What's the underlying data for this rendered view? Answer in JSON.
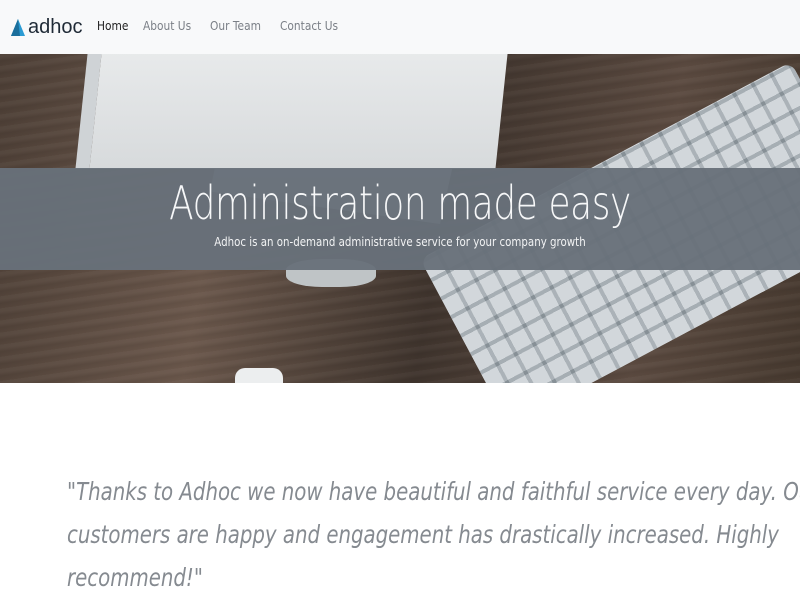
{
  "brand": {
    "name": "adhoc",
    "logo_icon": "triangle-logo-icon",
    "logo_color": "#2b9bd3"
  },
  "nav": {
    "items": [
      {
        "label": "Home",
        "active": true
      },
      {
        "label": "About Us",
        "active": false
      },
      {
        "label": "Our Team",
        "active": false
      },
      {
        "label": "Contact Us",
        "active": false
      }
    ]
  },
  "hero": {
    "title": "Administration made easy",
    "subtitle": "Adhoc is an on-demand administrative service for your company growth"
  },
  "testimonial": {
    "lines": [
      "\"Thanks to Adhoc we now have beautiful and faithful service every day. Our",
      "customers are happy and engagement has drastically increased. Highly",
      "recommend!\""
    ]
  },
  "colors": {
    "navbar_bg": "#f8f9fa",
    "hero_band": "#68707a",
    "testimonial_text": "#858a90"
  }
}
